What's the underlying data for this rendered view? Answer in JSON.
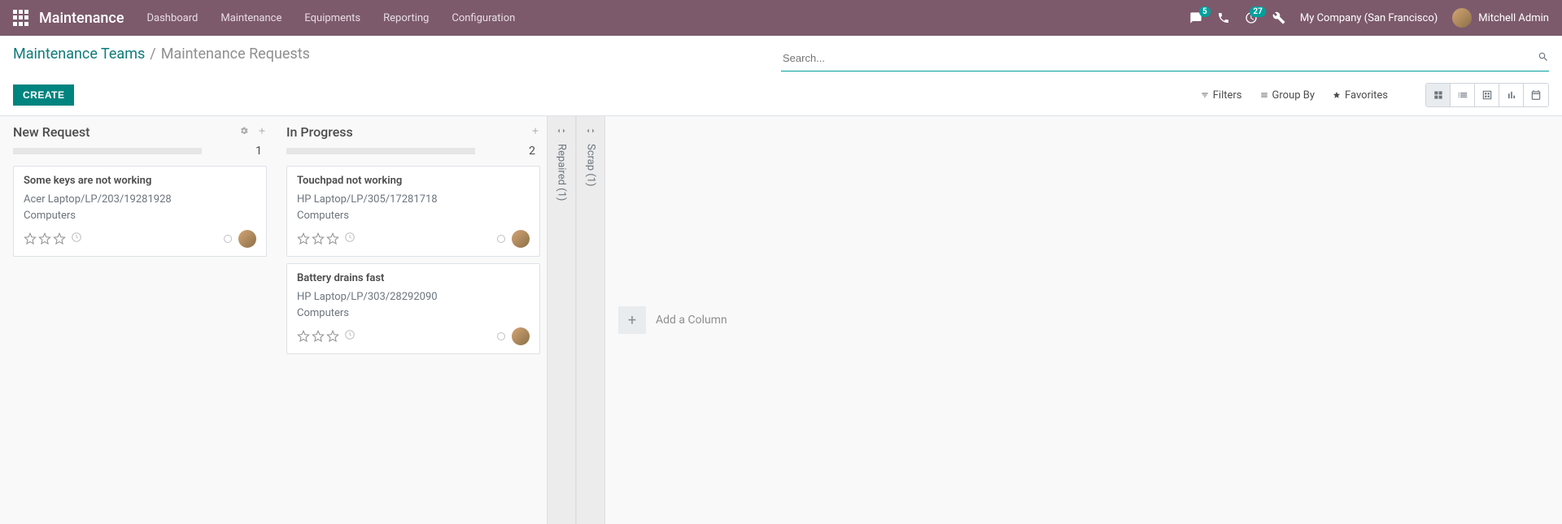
{
  "navbar": {
    "brand": "Maintenance",
    "menu": [
      "Dashboard",
      "Maintenance",
      "Equipments",
      "Reporting",
      "Configuration"
    ],
    "chat_badge": "5",
    "activity_badge": "27",
    "company": "My Company (San Francisco)",
    "user": "Mitchell Admin"
  },
  "breadcrumb": {
    "link": "Maintenance Teams",
    "current": "Maintenance Requests"
  },
  "search": {
    "placeholder": "Search..."
  },
  "buttons": {
    "create": "CREATE"
  },
  "search_options": {
    "filters": "Filters",
    "group_by": "Group By",
    "favorites": "Favorites"
  },
  "kanban": {
    "columns": [
      {
        "title": "New Request",
        "count": "1",
        "show_gear": true,
        "cards": [
          {
            "title": "Some keys are not working",
            "equipment": "Acer Laptop/LP/203/19281928",
            "category": "Computers"
          }
        ]
      },
      {
        "title": "In Progress",
        "count": "2",
        "show_gear": false,
        "cards": [
          {
            "title": "Touchpad not working",
            "equipment": "HP Laptop/LP/305/17281718",
            "category": "Computers"
          },
          {
            "title": "Battery drains fast",
            "equipment": "HP Laptop/LP/303/28292090",
            "category": "Computers"
          }
        ]
      }
    ],
    "folded": [
      {
        "title": "Repaired (1)"
      },
      {
        "title": "Scrap (1)"
      }
    ],
    "add_column": "Add a Column"
  }
}
